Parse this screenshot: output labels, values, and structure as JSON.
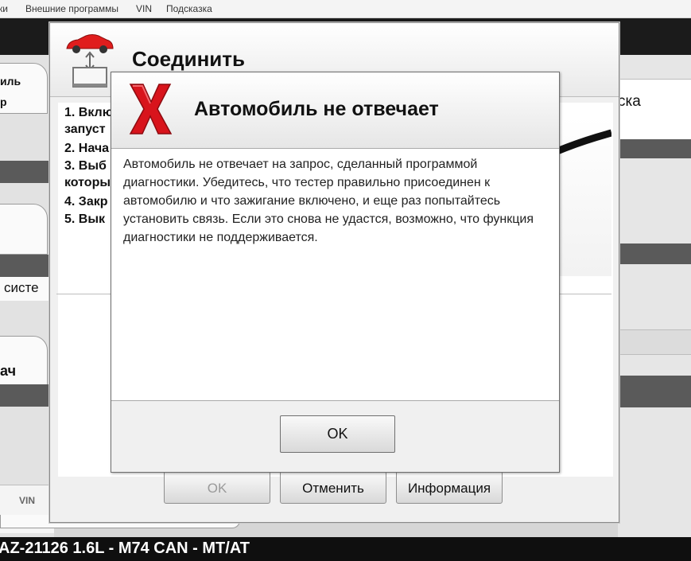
{
  "menubar": {
    "items": [
      "ки",
      "Внешние программы",
      "VIN",
      "Подсказка"
    ]
  },
  "left_panel": {
    "tab1_line1": "иль",
    "tab1_line2": "р",
    "systems_text": "систе",
    "tab3_text": "ач",
    "vin_label": "VIN"
  },
  "right_panel": {
    "heading_fragment": "ска"
  },
  "connect_dialog": {
    "title": "Соединить",
    "steps": [
      "1. Вклю",
      "запуст",
      "2. Нача",
      "3. Выб",
      "которы",
      "4. Закр",
      "5. Вык"
    ],
    "buttons": {
      "ok": "OK",
      "cancel": "Отменить",
      "info": "Информация"
    }
  },
  "alert_dialog": {
    "icon": "error-x-icon",
    "title": "Автомобиль не отвечает",
    "message": "Автомобиль не отвечает на запрос, сделанный программой диагностики. Убедитесь, что тестер правильно присоединен к автомобилю и что зажигание включено, и еще раз попытайтесь установить связь. Если это снова не удастся, возможно, что функция диагностики не поддерживается.",
    "ok_label": "OK"
  },
  "status_bar": {
    "vehicle": "AZ-21126 1.6L - M74 CAN - MT/AT"
  },
  "colors": {
    "error_red": "#d8141c",
    "car_icon_red": "#e01d1d",
    "dark_bar": "#1b1b1b"
  }
}
